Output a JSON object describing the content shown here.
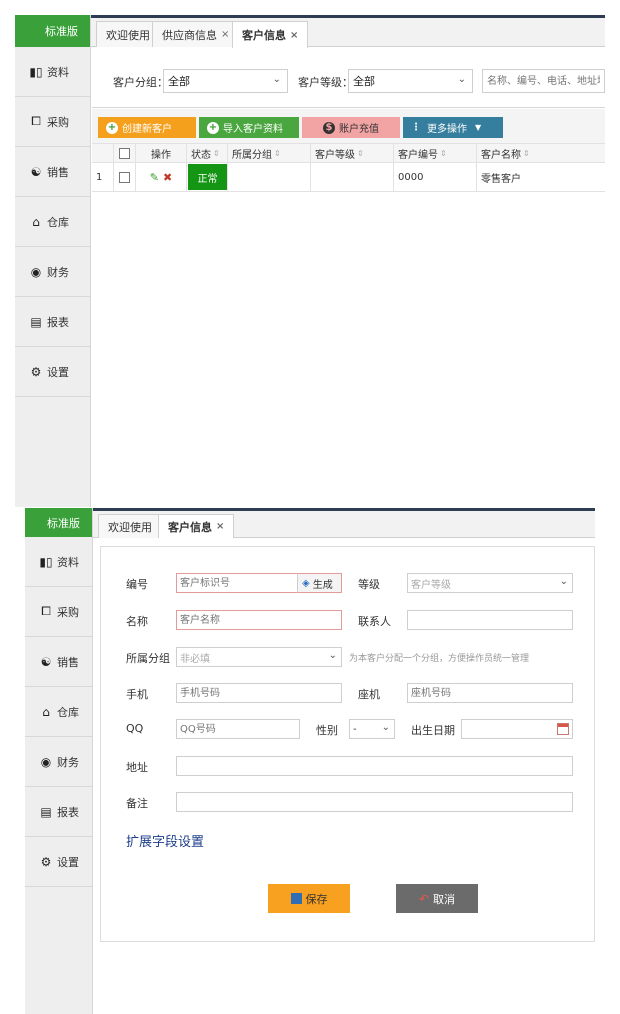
{
  "nav": {
    "brand": "标准版",
    "items": [
      {
        "label": "资料",
        "icon": "book-icon"
      },
      {
        "label": "采购",
        "icon": "cart-icon"
      },
      {
        "label": "销售",
        "icon": "handshake-icon"
      },
      {
        "label": "仓库",
        "icon": "warehouse-icon"
      },
      {
        "label": "财务",
        "icon": "coin-icon"
      },
      {
        "label": "报表",
        "icon": "report-icon"
      },
      {
        "label": "设置",
        "icon": "gear-icon"
      }
    ]
  },
  "list_view": {
    "tabs": [
      {
        "label": "欢迎使用",
        "closable": false
      },
      {
        "label": "供应商信息",
        "closable": true
      },
      {
        "label": "客户信息",
        "closable": true,
        "active": true
      }
    ],
    "filters": {
      "group_label": "客户分组：",
      "group_value": "全部",
      "level_label": "客户等级：",
      "level_value": "全部",
      "search_placeholder": "名称、编号、电话、地址均可"
    },
    "toolbar": {
      "create": "创建新客户",
      "import": "导入客户资料",
      "recharge": "账户充值",
      "more": "更多操作"
    },
    "columns": [
      "操作",
      "状态",
      "所属分组",
      "客户等级",
      "客户编号",
      "客户名称"
    ],
    "rows": [
      {
        "index": "1",
        "status": "正常",
        "group": "",
        "level": "",
        "code": "0000",
        "name": "零售客户"
      }
    ]
  },
  "edit_view": {
    "tabs": [
      {
        "label": "欢迎使用",
        "closable": false
      },
      {
        "label": "客户信息",
        "closable": true,
        "active": true
      }
    ],
    "form": {
      "code_label": "编号",
      "code_placeholder": "客户标识号",
      "generate_label": "生成",
      "level_label": "等级",
      "level_placeholder": "客户等级",
      "name_label": "名称",
      "name_placeholder": "客户名称",
      "contact_label": "联系人",
      "group_label": "所属分组",
      "group_placeholder": "非必填",
      "group_hint": "为本客户分配一个分组，方便操作员统一管理",
      "mobile_label": "手机",
      "mobile_placeholder": "手机号码",
      "phone_label": "座机",
      "phone_placeholder": "座机号码",
      "qq_label": "QQ",
      "qq_placeholder": "QQ号码",
      "gender_label": "性别",
      "gender_value": "-",
      "birthday_label": "出生日期",
      "address_label": "地址",
      "remark_label": "备注",
      "extend_label": "扩展字段设置",
      "save_label": "保存",
      "cancel_label": "取消"
    }
  },
  "colors": {
    "brand_green": "#3aa13a",
    "create_btn": "#f5a01d",
    "import_btn": "#4aa63f",
    "recharge_btn": "#f2a3a3",
    "more_btn": "#357e9d",
    "status_ok": "#149614",
    "save_btn": "#f8a01f",
    "cancel_btn": "#6b6b6b"
  }
}
